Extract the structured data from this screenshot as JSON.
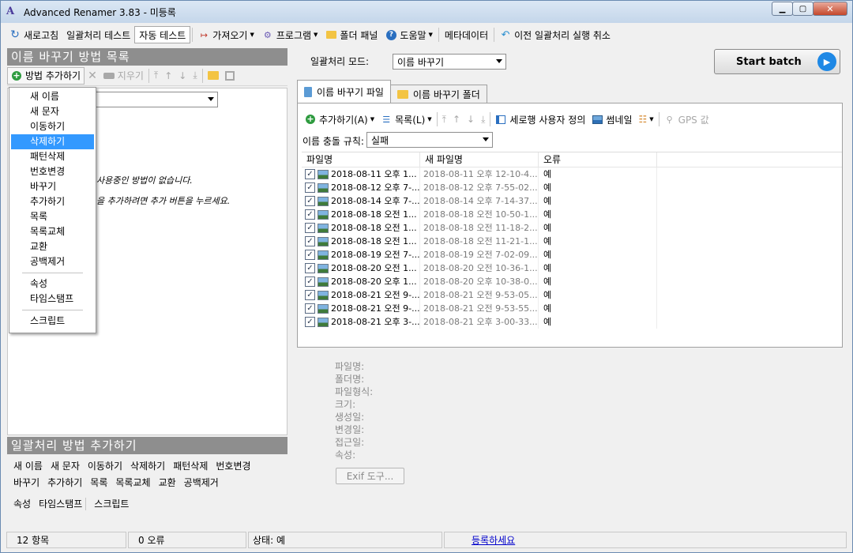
{
  "window": {
    "title": "Advanced Renamer 3.83 - 미등록",
    "minimize": "▁",
    "maximize": "▢",
    "close": "✕"
  },
  "toolbar": {
    "refresh": "새로고침",
    "batch_test": "일괄처리 테스트",
    "auto_test": "자동 테스트",
    "import": "가져오기",
    "programs": "프로그램",
    "folder_panel": "폴더 패널",
    "help": "도움말",
    "metadata": "메타데이터",
    "undo": "이전 일괄처리 실행 취소"
  },
  "method_list": {
    "header": "이름 바꾸기 방법 목록",
    "add_method": "방법 추가하기",
    "delete": "지우기",
    "empty_line1": "사용중인 방법이 없습니다.",
    "empty_line2": "을 추가하려면 추가 버튼을 누르세요."
  },
  "context_menu": {
    "items": [
      "새 이름",
      "새 문자",
      "이동하기",
      "삭제하기",
      "패턴삭제",
      "번호변경",
      "바꾸기",
      "추가하기",
      "목록",
      "목록교체",
      "교환",
      "공백제거"
    ],
    "items2": [
      "속성",
      "타임스탬프"
    ],
    "items3": [
      "스크립트"
    ],
    "highlighted": "삭제하기"
  },
  "add_methods": {
    "header": "일괄처리 방법 추가하기",
    "row1": [
      "새 이름",
      "새 문자",
      "이동하기",
      "삭제하기",
      "패턴삭제",
      "번호변경"
    ],
    "row2": [
      "바꾸기",
      "추가하기",
      "목록",
      "목록교체",
      "교환",
      "공백제거"
    ],
    "row3": [
      "속성",
      "타임스탬프",
      "스크립트"
    ]
  },
  "batch": {
    "mode_label": "일괄처리 모드:",
    "mode_value": "이름 바꾸기",
    "start": "Start batch"
  },
  "tabs": {
    "files": "이름 바꾸기 파일",
    "folders": "이름 바꾸기 폴더"
  },
  "file_toolbar": {
    "add": "추가하기(A)",
    "list": "목록(L)",
    "custom_columns": "세로행 사용자 정의",
    "thumbnail": "썸네일",
    "gps": "GPS 값"
  },
  "conflict": {
    "label": "이름 충돌 규칙:",
    "value": "실패"
  },
  "table": {
    "headers": [
      "파일명",
      "새 파일명",
      "오류"
    ],
    "rows": [
      {
        "name": "2018-08-11 오후 1...",
        "new": "2018-08-11 오후 12-10-4...",
        "err": "예"
      },
      {
        "name": "2018-08-12 오후 7-...",
        "new": "2018-08-12 오후 7-55-02...",
        "err": "예"
      },
      {
        "name": "2018-08-14 오후 7-...",
        "new": "2018-08-14 오후 7-14-37...",
        "err": "예"
      },
      {
        "name": "2018-08-18 오전 1...",
        "new": "2018-08-18 오전 10-50-1...",
        "err": "예"
      },
      {
        "name": "2018-08-18 오전 1...",
        "new": "2018-08-18 오전 11-18-2...",
        "err": "예"
      },
      {
        "name": "2018-08-18 오전 1...",
        "new": "2018-08-18 오전 11-21-1...",
        "err": "예"
      },
      {
        "name": "2018-08-19 오전 7-...",
        "new": "2018-08-19 오전 7-02-09...",
        "err": "예"
      },
      {
        "name": "2018-08-20 오전 1...",
        "new": "2018-08-20 오전 10-36-1...",
        "err": "예"
      },
      {
        "name": "2018-08-20 오후 1...",
        "new": "2018-08-20 오후 10-38-0...",
        "err": "예"
      },
      {
        "name": "2018-08-21 오전 9-...",
        "new": "2018-08-21 오전 9-53-05...",
        "err": "예"
      },
      {
        "name": "2018-08-21 오전 9-...",
        "new": "2018-08-21 오전 9-53-55...",
        "err": "예"
      },
      {
        "name": "2018-08-21 오후 3-...",
        "new": "2018-08-21 오후 3-00-33...",
        "err": "예"
      }
    ]
  },
  "file_info": {
    "labels": [
      "파일명:",
      "폴더명:",
      "파일형식:",
      "크기:",
      "생성일:",
      "변경일:",
      "접근일:",
      "속성:"
    ],
    "exif_button": "Exif 도구..."
  },
  "status": {
    "items": "12 항목",
    "errors": "0 오류",
    "state": "상태: 예",
    "register": "등록하세요"
  }
}
